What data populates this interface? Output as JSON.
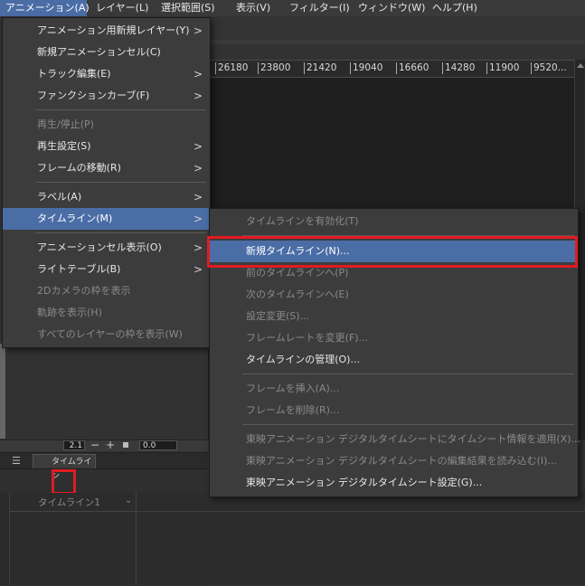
{
  "menubar": {
    "items": [
      {
        "label": "アニメーション(A)",
        "active": true
      },
      {
        "label": "レイヤー(L)"
      },
      {
        "label": "選択範囲(S)"
      },
      {
        "label": "表示(V)"
      },
      {
        "label": "フィルター(I)"
      },
      {
        "label": "ウィンドウ(W)"
      },
      {
        "label": "ヘルプ(H)"
      }
    ]
  },
  "ruler": {
    "values": [
      "26180",
      "23800",
      "21420",
      "19040",
      "16660",
      "14280",
      "11900",
      "9520..."
    ]
  },
  "statusbar": {
    "zoom": "2.1",
    "minus": "−",
    "plus": "+",
    "rotation": "0.0"
  },
  "panel": {
    "tab_label": "タイムライン",
    "timeline_name": "タイムライン1"
  },
  "animation_menu": {
    "items": [
      {
        "label": "アニメーション用新規レイヤー(Y)",
        "submenu": true
      },
      {
        "label": "新規アニメーションセル(C)"
      },
      {
        "label": "トラック編集(E)",
        "submenu": true
      },
      {
        "label": "ファンクションカーブ(F)",
        "submenu": true
      },
      {
        "label": "再生/停止(P)",
        "disabled": true
      },
      {
        "label": "再生設定(S)",
        "submenu": true
      },
      {
        "label": "フレームの移動(R)",
        "submenu": true
      },
      {
        "label": "ラベル(A)",
        "submenu": true
      },
      {
        "label": "タイムライン(M)",
        "submenu": true,
        "highlighted": true
      },
      {
        "label": "アニメーションセル表示(O)",
        "submenu": true
      },
      {
        "label": "ライトテーブル(B)",
        "submenu": true
      },
      {
        "label": "2Dカメラの枠を表示",
        "disabled": true
      },
      {
        "label": "軌跡を表示(H)",
        "disabled": true
      },
      {
        "label": "すべてのレイヤーの枠を表示(W)",
        "disabled": true
      }
    ]
  },
  "timeline_submenu": {
    "items": [
      {
        "label": "タイムラインを有効化(T)",
        "disabled": true
      },
      {
        "label": "新規タイムライン(N)...",
        "highlighted": true
      },
      {
        "label": "前のタイムラインへ(P)",
        "disabled": true
      },
      {
        "label": "次のタイムラインへ(E)",
        "disabled": true
      },
      {
        "label": "設定変更(S)...",
        "disabled": true
      },
      {
        "label": "フレームレートを変更(F)...",
        "disabled": true
      },
      {
        "label": "タイムラインの管理(O)..."
      },
      {
        "label": "フレームを挿入(A)...",
        "disabled": true
      },
      {
        "label": "フレームを削除(R)...",
        "disabled": true
      },
      {
        "label": "東映アニメーション デジタルタイムシートにタイムシート情報を適用(X)...",
        "disabled": true
      },
      {
        "label": "東映アニメーション デジタルタイムシートの編集結果を読み込む(I)...",
        "disabled": true
      },
      {
        "label": "東映アニメーション デジタルタイムシート設定(G)..."
      }
    ]
  },
  "arrow_glyph": ">",
  "colors": {
    "highlight": "#4a6da6",
    "annotation_red": "#e11b22"
  }
}
